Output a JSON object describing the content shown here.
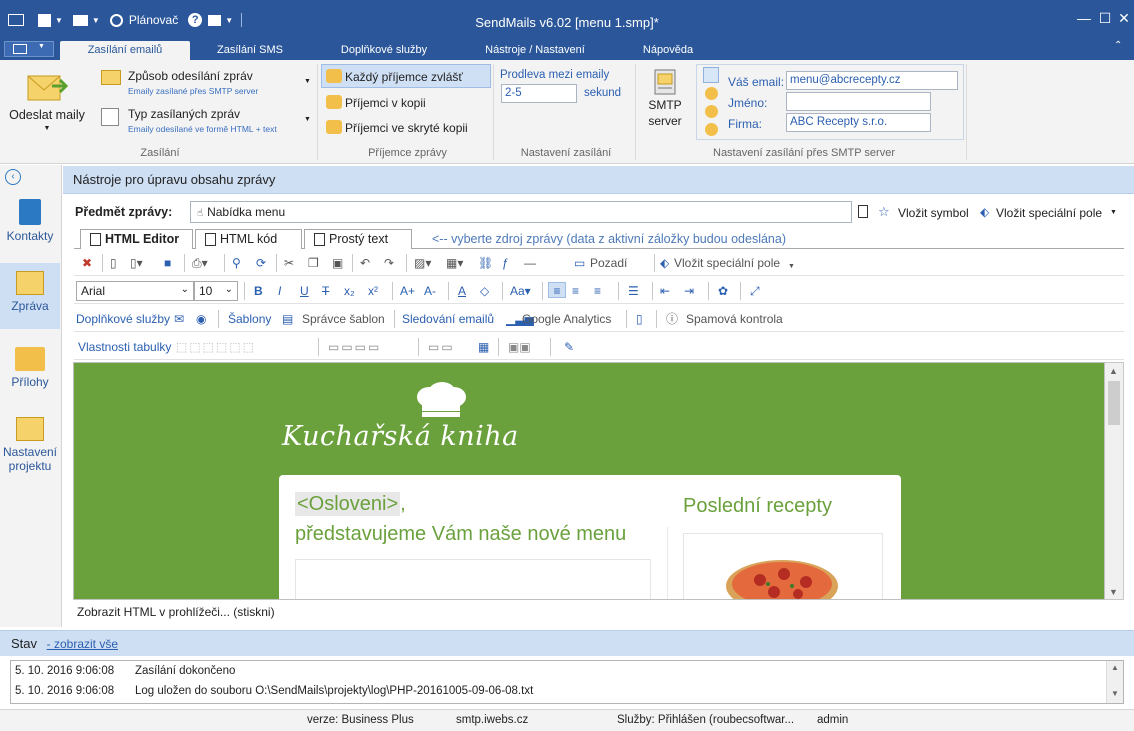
{
  "window": {
    "title": "SendMails v6.02 [menu 1.smp]*",
    "scheduler_label": "Plánovač"
  },
  "ribbon_tabs": [
    "Zasílání emailů",
    "Zasílání SMS",
    "Doplňkové služby",
    "Nástroje / Nastavení",
    "Nápověda"
  ],
  "ribbon": {
    "send_button": "Odeslat maily",
    "method_title": "Způsob odesílání zpráv",
    "method_sub": "Emaily zasílané přes SMTP server",
    "type_title": "Typ zasílaných zpráv",
    "type_sub": "Emaily odesílané ve formě HTML + text",
    "group_sending": "Zasílání",
    "recipient_each": "Každý příjemce zvlášť",
    "recipient_cc": "Příjemci v kopii",
    "recipient_bcc": "Příjemci ve skryté kopii",
    "group_recipients": "Příjemce zprávy",
    "delay_label": "Prodleva mezi emaily",
    "delay_value": "2-5",
    "delay_unit": "sekund",
    "group_settings": "Nastavení zasílání",
    "smtp_button_1": "SMTP",
    "smtp_button_2": "server",
    "email_label": "Váš email:",
    "email_value": "menu@abcrecepty.cz",
    "name_label": "Jméno:",
    "name_value": "",
    "company_label": "Firma:",
    "company_value": "ABC Recepty s.r.o.",
    "group_smtp": "Nastavení zasílání přes SMTP server"
  },
  "sidebar": [
    "Kontakty",
    "Zpráva",
    "Přílohy",
    "Nastavení projektu"
  ],
  "editor": {
    "panel_title": "Nástroje pro úpravu obsahu zprávy",
    "subject_label": "Předmět zprávy:",
    "subject_value": "Nabídka menu",
    "insert_symbol": "Vložit symbol",
    "insert_special": "Vložit speciální pole",
    "tabs": [
      "HTML Editor",
      "HTML kód",
      "Prostý text"
    ],
    "tab_hint": "<-- vyberte zdroj zprávy (data z aktivní záložky budou odeslána)",
    "background_btn": "Pozadí",
    "insert_special_2": "Vložit speciální pole",
    "font_name": "Arial",
    "font_size": "10",
    "addon_services": "Doplňkové služby",
    "templates": "Šablony",
    "template_manager": "Správce šablon",
    "tracking": "Sledování emailů",
    "analytics": "Google Analytics",
    "spam_check": "Spamová kontrola",
    "table_props": "Vlastnosti tabulky",
    "view_in_browser": "Zobrazit HTML v prohlížeči... (stiskni)"
  },
  "preview": {
    "brand": "Kuchařská kniha",
    "placeholder": "<Osloveni>",
    "comma": ",",
    "line2": "představujeme Vám naše nové menu",
    "recent": "Poslední recepty"
  },
  "status": {
    "title": "Stav",
    "show_all": "- zobrazit vše",
    "log": [
      {
        "time": "5. 10. 2016 9:06:08",
        "msg": "Zasílání dokončeno"
      },
      {
        "time": "5. 10. 2016 9:06:08",
        "msg": "Log uložen do souboru O:\\SendMails\\projekty\\log\\PHP-20161005-09-06-08.txt"
      }
    ]
  },
  "footer": {
    "version": "verze: Business Plus",
    "smtp": "smtp.iwebs.cz",
    "services": "Služby: Přihlášen (roubecsoftwar...",
    "user": "admin"
  },
  "colors": {
    "accent": "#2b579a",
    "panel": "#cfdff3",
    "preview_green": "#6aa13c"
  }
}
